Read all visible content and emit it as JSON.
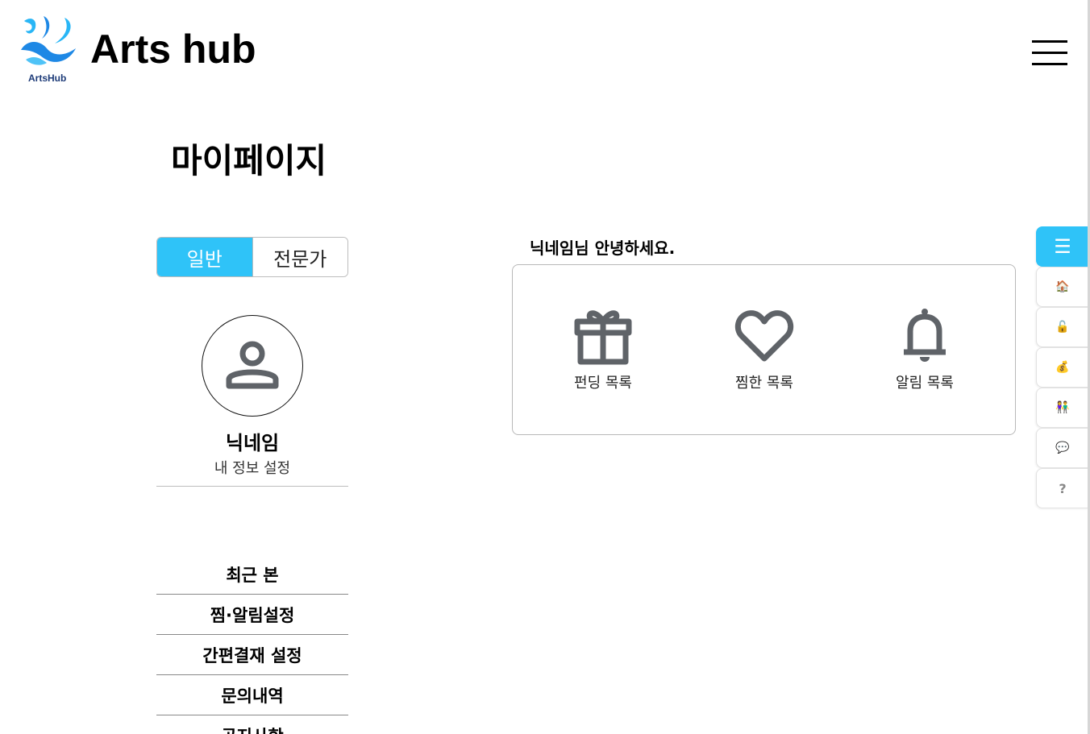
{
  "header": {
    "logo_caption": "ArtsHub",
    "brand": "Arts hub",
    "menu_icon": "hamburger-icon"
  },
  "page_title": "마이페이지",
  "profile_tabs": [
    {
      "label": "일반",
      "active": true
    },
    {
      "label": "전문가",
      "active": false
    }
  ],
  "profile": {
    "avatar_icon": "user-icon",
    "nickname": "닉네임",
    "settings_link": "내 정보 설정"
  },
  "side_menu": [
    {
      "label": "최근 본"
    },
    {
      "label": "찜·알림설정"
    },
    {
      "label": "간편결재 설정"
    },
    {
      "label": "문의내역"
    },
    {
      "label": "공지사항"
    }
  ],
  "greeting": "닉네임님 안녕하세요.",
  "shortcuts": [
    {
      "icon": "gift-icon",
      "label": "펀딩 목록"
    },
    {
      "icon": "heart-icon",
      "label": "찜한 목록"
    },
    {
      "icon": "bell-icon",
      "label": "알림 목록"
    }
  ],
  "quick_menu": [
    {
      "icon": "menu-icon",
      "glyph": "☰"
    },
    {
      "icon": "home-icon",
      "glyph": "🏠"
    },
    {
      "icon": "unlock-icon",
      "glyph": "🔓"
    },
    {
      "icon": "money-bag-icon",
      "glyph": "💰"
    },
    {
      "icon": "people-icon",
      "glyph": "👫"
    },
    {
      "icon": "speech-bubble-icon",
      "glyph": "💬"
    },
    {
      "icon": "question-icon",
      "glyph": "?"
    }
  ],
  "colors": {
    "accent": "#2fc3f8",
    "icon_gray": "#5f6368",
    "border": "#bdbdbd",
    "logo_blue": "#1aa3f0"
  }
}
